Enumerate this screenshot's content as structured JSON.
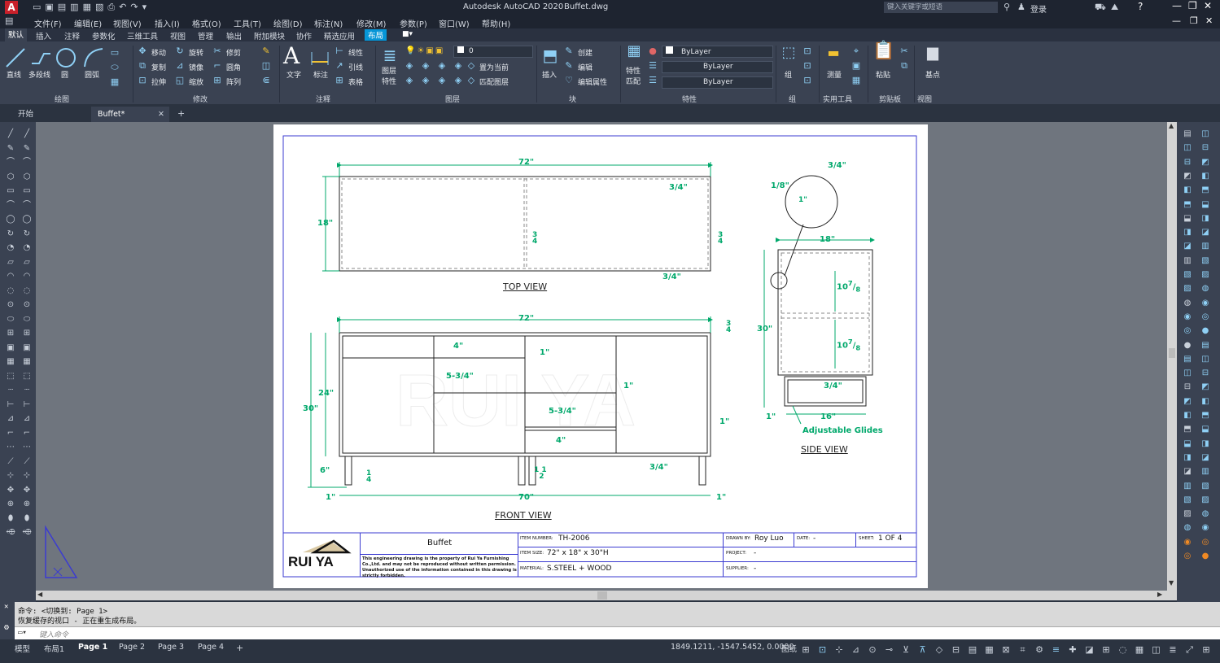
{
  "app": {
    "title": "Autodesk AutoCAD 2020",
    "file": "Buffet.dwg",
    "search_placeholder": "键入关键字或短语",
    "login": "登录"
  },
  "menu": [
    "文件(F)",
    "编辑(E)",
    "视图(V)",
    "插入(I)",
    "格式(O)",
    "工具(T)",
    "绘图(D)",
    "标注(N)",
    "修改(M)",
    "参数(P)",
    "窗口(W)",
    "帮助(H)"
  ],
  "ribbon_tabs": [
    "默认",
    "插入",
    "注释",
    "参数化",
    "三维工具",
    "视图",
    "管理",
    "输出",
    "附加模块",
    "协作",
    "精选应用",
    "布局"
  ],
  "ribbon": {
    "draw": {
      "line": "直线",
      "polyline": "多段线",
      "circle": "圆",
      "arc": "圆弧",
      "panel": "绘图"
    },
    "modify": {
      "move": "移动",
      "rotate": "旋转",
      "trim": "修剪",
      "copy": "复制",
      "mirror": "镜像",
      "fillet": "圆角",
      "stretch": "拉伸",
      "scale": "缩放",
      "array": "阵列",
      "panel": "修改"
    },
    "annotation": {
      "text": "文字",
      "dimension": "标注",
      "linear": "线性",
      "leader": "引线",
      "table": "表格",
      "panel": "注释"
    },
    "layers": {
      "props": "图层\n特性",
      "layer_value": "0",
      "set_current": "置为当前",
      "match": "匹配图层",
      "panel": "图层"
    },
    "block": {
      "insert": "插入",
      "create": "创建",
      "edit": "编辑",
      "edit_attr": "编辑属性",
      "panel": "块"
    },
    "properties": {
      "match": "特性\n匹配",
      "color": "ByLayer",
      "linetype": "ByLayer",
      "lineweight": "ByLayer",
      "panel": "特性"
    },
    "groups": {
      "group": "组",
      "panel": "组"
    },
    "utilities": {
      "measure": "测量",
      "panel": "实用工具"
    },
    "clipboard": {
      "paste": "粘贴",
      "panel": "剪贴板"
    },
    "view": {
      "base": "基点",
      "panel": "视图"
    }
  },
  "doc_tabs": [
    "开始",
    "Buffet*"
  ],
  "drawing": {
    "dims_top": {
      "width": "72\"",
      "depth": "18\"",
      "a": "3/4\"",
      "b": "3/4\"",
      "c1": "3",
      "c2": "4",
      "d1": "3",
      "d2": "4"
    },
    "dims_front": {
      "width": "72\"",
      "bottom": "70\"",
      "h30": "30\"",
      "h24": "24\"",
      "h6": "6\"",
      "l1": "1\"",
      "r1": "1\"",
      "r2": "1\"",
      "r3": "1\"",
      "d4a": "4\"",
      "d534a": "5-3/4\"",
      "d1a": "1\"",
      "d534b": "5-3/4\"",
      "d4b": "4\"",
      "d34": "3/4\"",
      "f34a": "3",
      "f34b": "4",
      "g1": "1",
      "g2": "4",
      "h1": "1",
      "h2": "1",
      "h3": "2"
    },
    "dims_side": {
      "depth": "18\"",
      "bottom": "16\"",
      "h30": "30\"",
      "detail_a": "3/4\"",
      "detail_b": "1/8\"",
      "detail_c": "1\"",
      "s1": "10",
      "s2": "7",
      "s3": "8",
      "s4": "3/4\"",
      "s5": "1\"",
      "glides": "Adjustable Glides"
    },
    "labels": {
      "top": "TOP VIEW",
      "front": "FRONT VIEW",
      "side": "SIDE VIEW"
    },
    "titleblock": {
      "logo": "RUI YA",
      "title": "Buffet",
      "notice": "This engineering drawing is the property of Rui Ya Furnishing Co.,Ltd. and may not be reproduced without written permission. Unauthorized use of the information contained in this drawing is strictly forbidden.",
      "item_number_label": "ITEM NUMBER:",
      "item_number": "TH-2006",
      "item_size_label": "ITEM SIZE:",
      "item_size": "72\" x 18\" x 30\"H",
      "material_label": "MATERIAL:",
      "material": "S.STEEL + WOOD",
      "drawn_by_label": "DRAWN BY:",
      "drawn_by": "Roy Luo",
      "date_label": "DATE:",
      "date": "-",
      "sheet_label": "SHEET:",
      "sheet": "1 OF 4",
      "project_label": "PROJECT:",
      "project": "-",
      "supplier_label": "SUPPLIER:",
      "supplier": "-"
    }
  },
  "command": {
    "line1": "命令: <切换到: Page 1>",
    "line2": "恢复缓存的视口 - 正在重生成布局。",
    "placeholder": "键入命令"
  },
  "layout_tabs": [
    "模型",
    "布局1",
    "Page 1",
    "Page 2",
    "Page 3",
    "Page 4"
  ],
  "status": {
    "coords": "1849.1211, -1547.5452, 0.0000",
    "space": "图纸"
  },
  "colors": {
    "dim": "#00a86b",
    "paper_border": "#3b3bd1",
    "accent": "#0696d7"
  }
}
